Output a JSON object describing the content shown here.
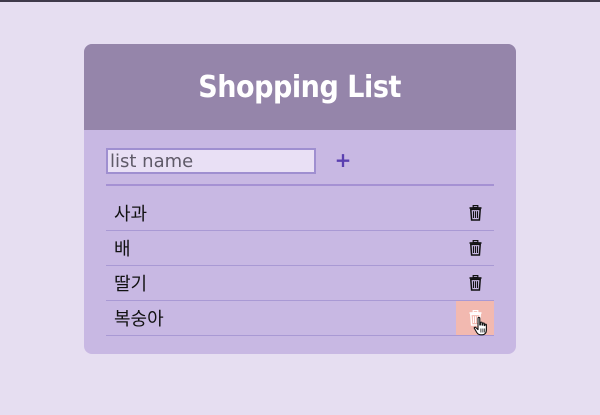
{
  "app": {
    "title": "Shopping List"
  },
  "form": {
    "placeholder": "list name",
    "value": "",
    "add_label": "+"
  },
  "items": [
    {
      "label": "사과"
    },
    {
      "label": "배"
    },
    {
      "label": "딸기"
    },
    {
      "label": "복숭아"
    }
  ],
  "icons": {
    "delete": "trash-icon",
    "cursor": "hand-pointer-icon"
  },
  "colors": {
    "page_background": "#e6def1",
    "card_background": "#c8b8e3",
    "header_background": "#9585aa",
    "title_text": "#ffffff",
    "add_button": "#5a3fb0",
    "delete_hover": "#f2b9b0"
  }
}
